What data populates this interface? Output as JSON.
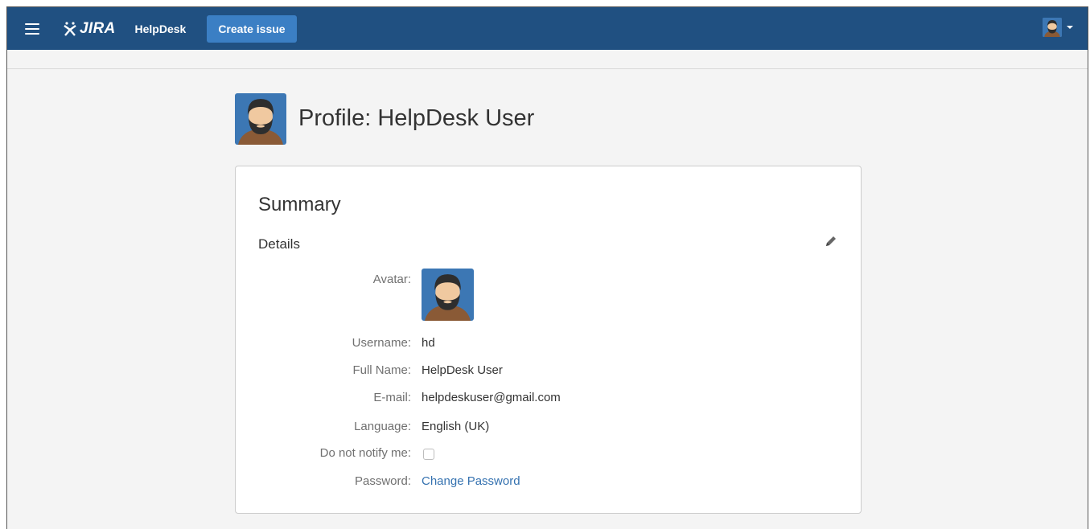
{
  "topbar": {
    "logo_text": "JIRA",
    "nav_label": "HelpDesk",
    "create_button": "Create issue",
    "background_color": "#205081",
    "button_color": "#3b7fc4",
    "user_avatar_icon": "user-avatar-icon"
  },
  "profile": {
    "title": "Profile: HelpDesk User"
  },
  "summary": {
    "title": "Summary",
    "details_title": "Details",
    "edit_icon": "pencil-icon",
    "fields": {
      "avatar_label": "Avatar:",
      "username_label": "Username:",
      "username_value": "hd",
      "fullname_label": "Full Name:",
      "fullname_value": "HelpDesk User",
      "email_label": "E-mail:",
      "email_value": "helpdeskuser@gmail.com",
      "language_label": "Language:",
      "language_value": "English (UK)",
      "notify_label": "Do not notify me:",
      "notify_checked": false,
      "password_label": "Password:",
      "password_link": "Change Password"
    }
  },
  "colors": {
    "link": "#3572b0",
    "page_background": "#f4f4f4"
  }
}
